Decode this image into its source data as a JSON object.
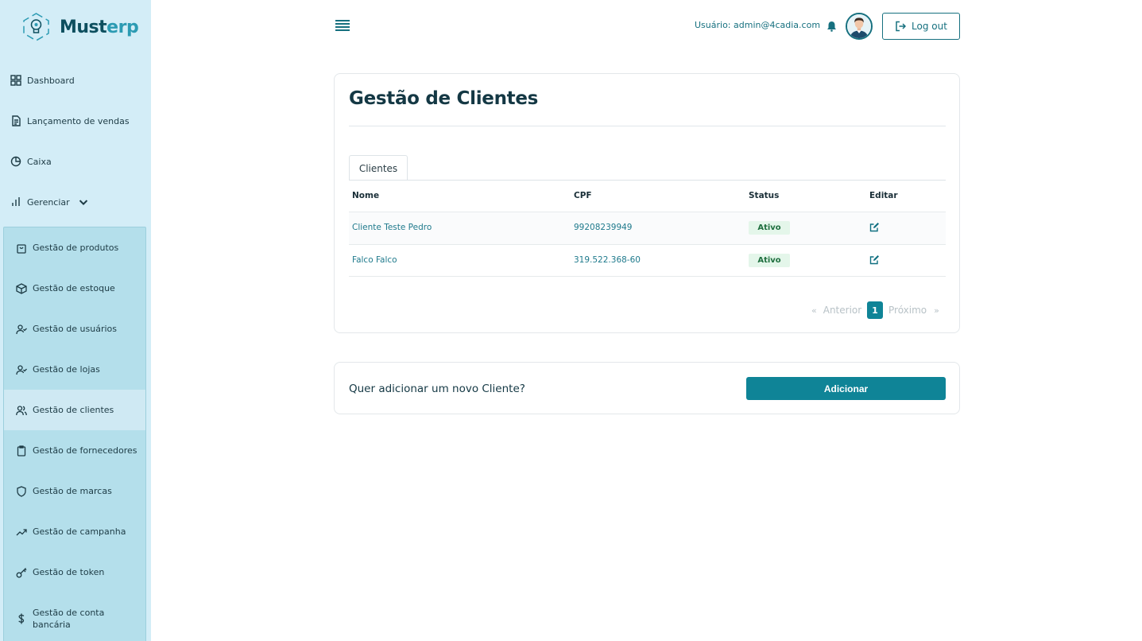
{
  "brand": {
    "name_main": "Must",
    "name_accent": "erp"
  },
  "nav": {
    "items": [
      {
        "label": "Dashboard",
        "icon": "grid-icon"
      },
      {
        "label": "Lançamento de vendas",
        "icon": "document-icon"
      },
      {
        "label": "Caixa",
        "icon": "pie-chart-icon"
      },
      {
        "label": "Gerenciar",
        "icon": "bar-chart-icon"
      }
    ],
    "submenu": [
      {
        "label": "Gestão de produtos",
        "icon": "shopping-bag-icon"
      },
      {
        "label": "Gestão de estoque",
        "icon": "box-icon"
      },
      {
        "label": "Gestão de usuários",
        "icon": "user-check-icon"
      },
      {
        "label": "Gestão de lojas",
        "icon": "user-check-icon"
      },
      {
        "label": "Gestão de clientes",
        "icon": "users-icon",
        "active": true
      },
      {
        "label": "Gestão de fornecedores",
        "icon": "clipboard-icon"
      },
      {
        "label": "Gestão de marcas",
        "icon": "shield-icon"
      },
      {
        "label": "Gestão de campanha",
        "icon": "trending-up-icon"
      },
      {
        "label": "Gestão de token",
        "icon": "key-icon"
      },
      {
        "label": "Gestão de conta bancária",
        "icon": "dollar-icon"
      }
    ]
  },
  "header": {
    "user_label": "Usuário: admin@4cadia.com",
    "logout_label": "Log out"
  },
  "main": {
    "title": "Gestão de Clientes",
    "tab_label": "Clientes",
    "table": {
      "headers": {
        "nome": "Nome",
        "cpf": "CPF",
        "status": "Status",
        "editar": "Editar"
      },
      "rows": [
        {
          "nome": "Cliente Teste Pedro",
          "cpf": "99208239949",
          "status": "Ativo"
        },
        {
          "nome": "Falco Falco",
          "cpf": "319.522.368-60",
          "status": "Ativo"
        }
      ]
    },
    "pagination": {
      "prev": "Anterior",
      "next": "Próximo",
      "current": "1",
      "prev_symbol": "«",
      "next_symbol": "»"
    }
  },
  "add_card": {
    "question": "Quer adicionar um novo Cliente?",
    "button_label": "Adicionar"
  },
  "colors": {
    "accent": "#0f8497",
    "sidebar_bg": "#d3edf7",
    "submenu_bg": "#b4dfeb",
    "active_badge_bg": "#e4f6ea"
  }
}
